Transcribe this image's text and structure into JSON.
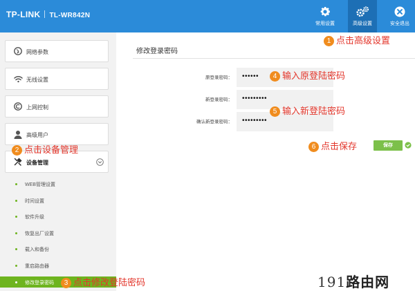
{
  "header": {
    "brand": "TP-LINK",
    "model": "TL-WR842N",
    "buttons": [
      {
        "label": "常用设置",
        "icon": "gear-icon"
      },
      {
        "label": "高级设置",
        "icon": "gears-icon"
      },
      {
        "label": "安全退出",
        "icon": "close-icon"
      }
    ]
  },
  "sidebar": {
    "items": [
      {
        "label": "网络参数",
        "icon": "globe-icon"
      },
      {
        "label": "无线设置",
        "icon": "wifi-icon"
      },
      {
        "label": "上网控制",
        "icon": "control-icon"
      },
      {
        "label": "高级用户",
        "icon": "user-icon"
      },
      {
        "label": "设备管理",
        "icon": "tools-icon"
      }
    ],
    "subitems": [
      "WEB管理设置",
      "时间设置",
      "软件升级",
      "恢复出厂设置",
      "载入和备份",
      "重启路由器",
      "修改登录密码"
    ]
  },
  "main": {
    "title": "修改登录密码",
    "fields": [
      {
        "label": "原登录密码：",
        "value": "••••••"
      },
      {
        "label": "新登录密码：",
        "value": "•••••••••"
      },
      {
        "label": "确认新登录密码：",
        "value": "•••••••••"
      }
    ],
    "save_label": "保存"
  },
  "annotations": {
    "a1": {
      "num": "1",
      "text": "点击高级设置"
    },
    "a2": {
      "num": "2",
      "text": "点击设备管理"
    },
    "a3": {
      "num": "3",
      "text": "点击修改登陆密码"
    },
    "a4": {
      "num": "4",
      "text": "输入原登陆密码"
    },
    "a5": {
      "num": "5",
      "text": "输入新登陆密码"
    },
    "a6": {
      "num": "6",
      "text": "点击保存"
    }
  },
  "watermark": {
    "digits": "191",
    "text": "路由网"
  },
  "colors": {
    "header_blue": "#2b8bd9",
    "active_green": "#6eb41f",
    "annotation_red": "#e3362b",
    "badge_orange": "#f08c1e"
  }
}
